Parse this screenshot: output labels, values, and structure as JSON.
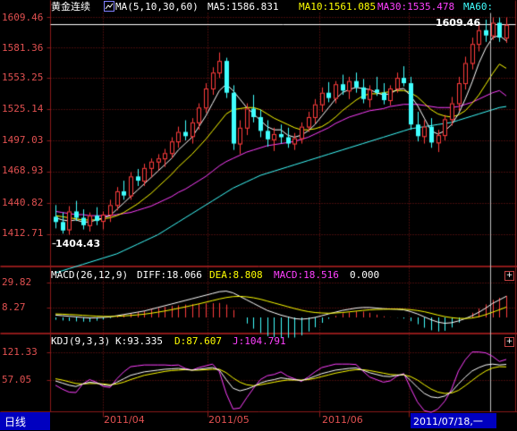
{
  "main_panel": {
    "symbol": "黄金连续",
    "ma_label": "MA(5,10,30,60)",
    "ma5": "MA5:1586.831",
    "ma10": "MA10:1561.085",
    "ma30": "MA30:1535.478",
    "ma60": "MA60:",
    "y_ticks": [
      "1609.46",
      "1581.36",
      "1553.25",
      "1525.14",
      "1497.03",
      "1468.93",
      "1440.82",
      "1412.71"
    ],
    "high_marker": "1609.46",
    "low_marker": "1404.43"
  },
  "macd_panel": {
    "label": "MACD(26,12,9)",
    "diff": "DIFF:18.066",
    "dea": "DEA:8.808",
    "macd": "MACD:18.516",
    "zero": "0.000",
    "y_ticks": [
      "29.82",
      "8.27"
    ],
    "expand_icon": "+"
  },
  "kdj_panel": {
    "label": "KDJ(9,3,3)",
    "k": "K:93.335",
    "d": "D:87.607",
    "j": "J:104.791",
    "y_ticks": [
      "121.33",
      "57.05"
    ],
    "expand_icon": "+"
  },
  "bottom_bar": {
    "period_tab": "日线",
    "dates": [
      "2011/04",
      "2011/05",
      "2011/06"
    ],
    "cursor_date": "2011/07/18,一"
  },
  "colors": {
    "background": "#000000",
    "grid": "#8b1a1a",
    "up_candle": "#ff3c3c",
    "down_candle": "#40ffff",
    "ma5": "#ffffff",
    "ma10": "#ffff00",
    "ma30": "#ff40ff",
    "ma60": "#40ffff",
    "tab_bg": "#0000c0",
    "cursor_bg": "#0000c0"
  },
  "chart_data": {
    "type": "candlestick",
    "price_range": [
      1404.43,
      1609.46
    ],
    "candles": [
      {
        "o": 1421,
        "h": 1432,
        "l": 1410,
        "c": 1416
      },
      {
        "o": 1416,
        "h": 1425,
        "l": 1405,
        "c": 1408
      },
      {
        "o": 1409,
        "h": 1431,
        "l": 1404,
        "c": 1426
      },
      {
        "o": 1426,
        "h": 1436,
        "l": 1417,
        "c": 1420
      },
      {
        "o": 1420,
        "h": 1428,
        "l": 1409,
        "c": 1413
      },
      {
        "o": 1413,
        "h": 1425,
        "l": 1407,
        "c": 1422
      },
      {
        "o": 1422,
        "h": 1430,
        "l": 1413,
        "c": 1417
      },
      {
        "o": 1417,
        "h": 1426,
        "l": 1409,
        "c": 1423
      },
      {
        "o": 1423,
        "h": 1437,
        "l": 1416,
        "c": 1432
      },
      {
        "o": 1432,
        "h": 1449,
        "l": 1427,
        "c": 1445
      },
      {
        "o": 1445,
        "h": 1455,
        "l": 1437,
        "c": 1441
      },
      {
        "o": 1441,
        "h": 1463,
        "l": 1437,
        "c": 1459
      },
      {
        "o": 1459,
        "h": 1466,
        "l": 1450,
        "c": 1455
      },
      {
        "o": 1455,
        "h": 1471,
        "l": 1450,
        "c": 1467
      },
      {
        "o": 1467,
        "h": 1476,
        "l": 1458,
        "c": 1473
      },
      {
        "o": 1473,
        "h": 1480,
        "l": 1465,
        "c": 1476
      },
      {
        "o": 1476,
        "h": 1485,
        "l": 1468,
        "c": 1481
      },
      {
        "o": 1481,
        "h": 1496,
        "l": 1476,
        "c": 1492
      },
      {
        "o": 1492,
        "h": 1506,
        "l": 1486,
        "c": 1501
      },
      {
        "o": 1501,
        "h": 1512,
        "l": 1493,
        "c": 1497
      },
      {
        "o": 1497,
        "h": 1514,
        "l": 1490,
        "c": 1510
      },
      {
        "o": 1510,
        "h": 1528,
        "l": 1503,
        "c": 1524
      },
      {
        "o": 1524,
        "h": 1547,
        "l": 1519,
        "c": 1542
      },
      {
        "o": 1542,
        "h": 1562,
        "l": 1536,
        "c": 1557
      },
      {
        "o": 1557,
        "h": 1576,
        "l": 1552,
        "c": 1568
      },
      {
        "o": 1568,
        "h": 1571,
        "l": 1533,
        "c": 1538
      },
      {
        "o": 1538,
        "h": 1545,
        "l": 1484,
        "c": 1490
      },
      {
        "o": 1490,
        "h": 1512,
        "l": 1480,
        "c": 1505
      },
      {
        "o": 1505,
        "h": 1528,
        "l": 1498,
        "c": 1523
      },
      {
        "o": 1523,
        "h": 1536,
        "l": 1510,
        "c": 1515
      },
      {
        "o": 1515,
        "h": 1522,
        "l": 1496,
        "c": 1502
      },
      {
        "o": 1502,
        "h": 1512,
        "l": 1487,
        "c": 1494
      },
      {
        "o": 1494,
        "h": 1505,
        "l": 1483,
        "c": 1499
      },
      {
        "o": 1499,
        "h": 1508,
        "l": 1490,
        "c": 1496
      },
      {
        "o": 1496,
        "h": 1505,
        "l": 1486,
        "c": 1490
      },
      {
        "o": 1490,
        "h": 1500,
        "l": 1484,
        "c": 1495
      },
      {
        "o": 1495,
        "h": 1510,
        "l": 1490,
        "c": 1506
      },
      {
        "o": 1506,
        "h": 1520,
        "l": 1501,
        "c": 1515
      },
      {
        "o": 1515,
        "h": 1532,
        "l": 1509,
        "c": 1527
      },
      {
        "o": 1527,
        "h": 1543,
        "l": 1520,
        "c": 1538
      },
      {
        "o": 1538,
        "h": 1548,
        "l": 1529,
        "c": 1533
      },
      {
        "o": 1533,
        "h": 1549,
        "l": 1528,
        "c": 1546
      },
      {
        "o": 1546,
        "h": 1555,
        "l": 1536,
        "c": 1540
      },
      {
        "o": 1540,
        "h": 1553,
        "l": 1532,
        "c": 1549
      },
      {
        "o": 1549,
        "h": 1557,
        "l": 1538,
        "c": 1543
      },
      {
        "o": 1543,
        "h": 1551,
        "l": 1528,
        "c": 1532
      },
      {
        "o": 1532,
        "h": 1545,
        "l": 1524,
        "c": 1541
      },
      {
        "o": 1541,
        "h": 1553,
        "l": 1535,
        "c": 1538
      },
      {
        "o": 1538,
        "h": 1547,
        "l": 1527,
        "c": 1531
      },
      {
        "o": 1531,
        "h": 1545,
        "l": 1526,
        "c": 1542
      },
      {
        "o": 1542,
        "h": 1557,
        "l": 1538,
        "c": 1552
      },
      {
        "o": 1552,
        "h": 1563,
        "l": 1544,
        "c": 1547
      },
      {
        "o": 1547,
        "h": 1553,
        "l": 1503,
        "c": 1508
      },
      {
        "o": 1508,
        "h": 1520,
        "l": 1492,
        "c": 1497
      },
      {
        "o": 1497,
        "h": 1512,
        "l": 1490,
        "c": 1506
      },
      {
        "o": 1506,
        "h": 1514,
        "l": 1486,
        "c": 1491
      },
      {
        "o": 1491,
        "h": 1503,
        "l": 1482,
        "c": 1498
      },
      {
        "o": 1498,
        "h": 1517,
        "l": 1493,
        "c": 1513
      },
      {
        "o": 1513,
        "h": 1534,
        "l": 1507,
        "c": 1528
      },
      {
        "o": 1528,
        "h": 1553,
        "l": 1521,
        "c": 1547
      },
      {
        "o": 1547,
        "h": 1572,
        "l": 1541,
        "c": 1566
      },
      {
        "o": 1566,
        "h": 1590,
        "l": 1560,
        "c": 1584
      },
      {
        "o": 1584,
        "h": 1603,
        "l": 1577,
        "c": 1597
      },
      {
        "o": 1597,
        "h": 1607,
        "l": 1586,
        "c": 1592
      },
      {
        "o": 1592,
        "h": 1609,
        "l": 1588,
        "c": 1604
      },
      {
        "o": 1604,
        "h": 1609,
        "l": 1586,
        "c": 1590
      },
      {
        "o": 1590,
        "h": 1609,
        "l": 1585,
        "c": 1602
      }
    ],
    "ma5": [
      1420,
      1418,
      1417,
      1418,
      1416,
      1416,
      1418,
      1420,
      1422,
      1428,
      1434,
      1440,
      1446,
      1452,
      1458,
      1464,
      1470,
      1476,
      1484,
      1490,
      1496,
      1506,
      1516,
      1528,
      1540,
      1546,
      1540,
      1532,
      1524,
      1518,
      1512,
      1506,
      1503,
      1503,
      1498,
      1496,
      1498,
      1502,
      1508,
      1516,
      1524,
      1532,
      1538,
      1541,
      1543,
      1542,
      1541,
      1538,
      1536,
      1537,
      1541,
      1542,
      1535,
      1526,
      1514,
      1502,
      1499,
      1502,
      1508,
      1518,
      1532,
      1548,
      1566,
      1580,
      1590,
      1592,
      1587
    ],
    "ma10": [
      1422,
      1421,
      1420,
      1419,
      1418,
      1418,
      1418,
      1419,
      1420,
      1422,
      1425,
      1429,
      1433,
      1438,
      1443,
      1449,
      1455,
      1461,
      1468,
      1474,
      1480,
      1487,
      1494,
      1502,
      1510,
      1518,
      1522,
      1523,
      1524,
      1524,
      1522,
      1518,
      1514,
      1511,
      1508,
      1505,
      1503,
      1503,
      1504,
      1506,
      1510,
      1515,
      1521,
      1526,
      1531,
      1535,
      1537,
      1537,
      1538,
      1539,
      1540,
      1540,
      1538,
      1534,
      1528,
      1522,
      1518,
      1516,
      1515,
      1517,
      1521,
      1528,
      1536,
      1546,
      1556,
      1565,
      1561
    ],
    "ma30": [
      1426,
      1425,
      1424,
      1423,
      1423,
      1422,
      1422,
      1422,
      1422,
      1423,
      1424,
      1425,
      1427,
      1429,
      1431,
      1434,
      1437,
      1440,
      1444,
      1447,
      1451,
      1455,
      1459,
      1464,
      1469,
      1473,
      1476,
      1479,
      1482,
      1484,
      1486,
      1488,
      1489,
      1490,
      1491,
      1492,
      1494,
      1496,
      1499,
      1502,
      1505,
      1509,
      1512,
      1515,
      1517,
      1519,
      1521,
      1522,
      1523,
      1525,
      1526,
      1527,
      1527,
      1527,
      1526,
      1525,
      1524,
      1524,
      1524,
      1525,
      1527,
      1529,
      1532,
      1535,
      1538,
      1540,
      1535
    ],
    "ma60": [
      1368,
      1370,
      1372,
      1374,
      1376,
      1378,
      1380,
      1382,
      1384,
      1386,
      1389,
      1392,
      1395,
      1398,
      1401,
      1404,
      1408,
      1412,
      1416,
      1420,
      1424,
      1428,
      1432,
      1436,
      1440,
      1444,
      1448,
      1451,
      1454,
      1457,
      1460,
      1462,
      1464,
      1466,
      1468,
      1470,
      1472,
      1474,
      1476,
      1478,
      1480,
      1482,
      1484,
      1486,
      1488,
      1490,
      1492,
      1494,
      1496,
      1498,
      1500,
      1502,
      1504,
      1505,
      1506,
      1507,
      1508,
      1509,
      1510,
      1512,
      1514,
      1516,
      1518,
      1520,
      1522,
      1524,
      1525
    ],
    "macd_range": [
      -8,
      30
    ],
    "diff": [
      2,
      1.5,
      1,
      0.5,
      0,
      -0.5,
      -0.3,
      0,
      0.5,
      1.5,
      2.5,
      3.5,
      4.5,
      5.5,
      7,
      8.5,
      10,
      11.5,
      13,
      14.5,
      16,
      17.5,
      19,
      20.5,
      22,
      22.5,
      21,
      18,
      15,
      12,
      9,
      6,
      4,
      2,
      0.5,
      -1,
      -1.5,
      -1,
      0,
      1.5,
      3,
      4.5,
      6,
      7,
      8,
      8.5,
      8.5,
      8,
      7.5,
      7.2,
      7,
      6.5,
      5,
      3,
      0.5,
      -2,
      -4,
      -5,
      -4.5,
      -3,
      -1,
      1.5,
      4.5,
      8,
      12,
      15,
      18.066
    ],
    "dea": [
      3,
      2.8,
      2.5,
      2.2,
      1.8,
      1.4,
      1.1,
      0.9,
      0.8,
      1,
      1.3,
      1.7,
      2.2,
      2.8,
      3.6,
      4.5,
      5.5,
      6.6,
      7.8,
      9,
      10.3,
      11.6,
      13,
      14.4,
      15.8,
      17,
      17.8,
      18,
      17.6,
      16.8,
      15.6,
      14,
      12.4,
      10.8,
      9.2,
      7.6,
      6.2,
      5,
      4.2,
      3.8,
      3.6,
      3.8,
      4.2,
      4.8,
      5.4,
      6,
      6.5,
      6.8,
      7,
      7.1,
      7.1,
      7,
      6.6,
      5.9,
      4.9,
      3.5,
      2,
      0.7,
      -0.2,
      -0.8,
      -0.9,
      -0.5,
      0.7,
      2.4,
      4.5,
      6.6,
      8.808
    ],
    "kdj_range": [
      0,
      121.33
    ],
    "k": [
      55,
      50,
      45,
      42,
      48,
      52,
      50,
      46,
      44,
      52,
      60,
      68,
      72,
      76,
      78,
      80,
      82,
      83,
      84,
      82,
      80,
      82,
      84,
      86,
      80,
      58,
      38,
      32,
      36,
      42,
      50,
      55,
      58,
      62,
      60,
      58,
      56,
      60,
      66,
      72,
      76,
      80,
      82,
      84,
      85,
      80,
      74,
      70,
      66,
      65,
      68,
      70,
      56,
      40,
      26,
      18,
      16,
      20,
      30,
      48,
      64,
      78,
      86,
      92,
      94,
      92,
      93.335
    ],
    "d": [
      60,
      57,
      53,
      49,
      48,
      49,
      49,
      48,
      46,
      48,
      52,
      58,
      63,
      68,
      71,
      74,
      77,
      79,
      80,
      81,
      80,
      80,
      81,
      82,
      82,
      74,
      62,
      52,
      46,
      44,
      46,
      49,
      52,
      55,
      57,
      57,
      57,
      58,
      61,
      65,
      69,
      73,
      76,
      79,
      81,
      81,
      79,
      76,
      73,
      70,
      69,
      69,
      65,
      57,
      46,
      36,
      29,
      26,
      27,
      33,
      44,
      56,
      68,
      78,
      85,
      88,
      87.607
    ],
    "j": [
      45,
      36,
      29,
      28,
      48,
      58,
      52,
      42,
      40,
      60,
      76,
      88,
      90,
      92,
      92,
      92,
      92,
      91,
      92,
      84,
      80,
      86,
      90,
      94,
      76,
      26,
      -10,
      -8,
      16,
      38,
      58,
      67,
      70,
      76,
      66,
      60,
      54,
      64,
      76,
      86,
      90,
      94,
      94,
      94,
      93,
      78,
      64,
      58,
      52,
      55,
      66,
      72,
      38,
      6,
      -14,
      -18,
      -10,
      8,
      36,
      78,
      104,
      122,
      122,
      120,
      112,
      100,
      104.791
    ]
  }
}
